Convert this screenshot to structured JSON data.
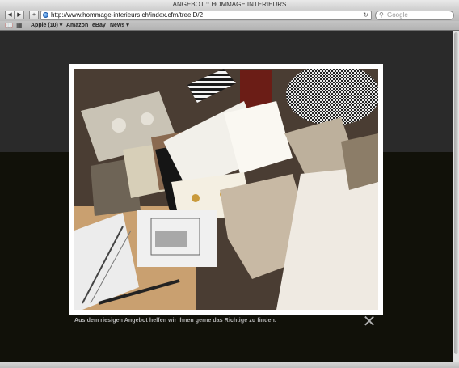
{
  "window": {
    "title": "ANGEBOT :: HOMMAGE INTERIEURS"
  },
  "toolbar": {
    "back_icon": "back-arrow-icon",
    "forward_icon": "forward-arrow-icon",
    "add_icon": "plus-icon",
    "url": "http://www.hommage-interieurs.ch/index.cfm/treeID/2",
    "reload_icon": "reload-icon",
    "search_placeholder": "Google"
  },
  "bookmarks": {
    "items": [
      {
        "label": "Apple (10) ▾"
      },
      {
        "label": "Amazon"
      },
      {
        "label": "eBay"
      },
      {
        "label": "News ▾"
      }
    ]
  },
  "lightbox": {
    "caption": "Aus dem riesigen Angebot helfen wir Ihnen gerne das Richtige zu finden.",
    "close_label": "✕"
  },
  "colors": {
    "page_top": "#2a2a2a",
    "page_bottom": "#111109",
    "caption": "#b7b7b7"
  }
}
